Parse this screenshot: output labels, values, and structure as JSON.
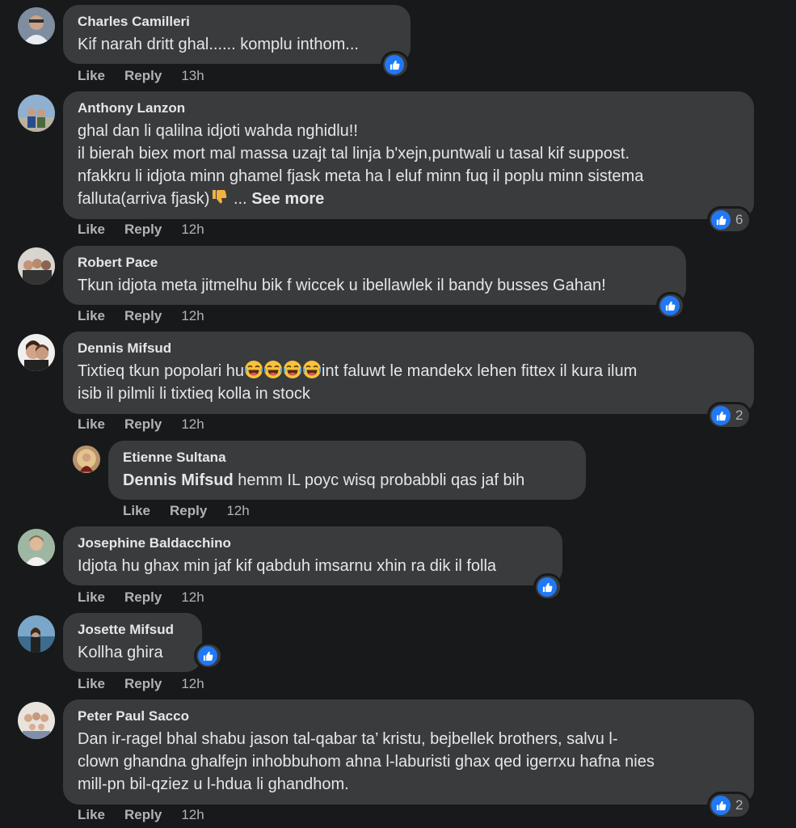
{
  "actions": {
    "like": "Like",
    "reply": "Reply"
  },
  "comments": [
    {
      "author": "Charles Camilleri",
      "text": "Kif narah dritt ghal...... komplu inthom...",
      "time": "13h",
      "reactions": ""
    },
    {
      "author": "Anthony Lanzon",
      "text": "ghal dan li qalilna idjoti wahda nghidlu!!\nil bierah biex mort mal massa uzajt tal linja b'xejn,puntwali u tasal kif suppost.\nnfakkru li idjota minn ghamel fjask meta ha l eluf minn fuq il poplu minn sistema\nfalluta(arriva fjask)",
      "see_more": "See more",
      "time": "12h",
      "reactions": "6"
    },
    {
      "author": "Robert Pace",
      "text": "Tkun idjota meta jitmelhu bik f wiccek u ibellawlek il bandy busses Gahan!",
      "time": "12h",
      "reactions": ""
    },
    {
      "author": "Dennis Mifsud",
      "text_a": "Tixtieq tkun popolari hu",
      "text_b": "int faluwt le mandekx lehen fittex il kura ilum\nisib il pilmli li tixtieq kolla in stock",
      "time": "12h",
      "reactions": "2"
    },
    {
      "author": "Etienne Sultana",
      "mention": "Dennis Mifsud",
      "text": " hemm IL poyc wisq probabbli qas jaf bih",
      "time": "12h",
      "reactions": ""
    },
    {
      "author": "Josephine Baldacchino",
      "text": "Idjota hu ghax min jaf kif qabduh imsarnu xhin ra dik il folla",
      "time": "12h",
      "reactions": ""
    },
    {
      "author": "Josette Mifsud",
      "text": "Kollha ghira",
      "time": "12h",
      "reactions": ""
    },
    {
      "author": "Peter Paul Sacco",
      "text": "Dan ir-ragel bhal shabu jason tal-qabar ta’ kristu, bejbellek brothers, salvu l-\nclown ghandna ghalfejn inhobbuhom ahna l-laburisti ghax qed igerrxu hafna nies\nmill-pn bil-qziez u l-hdua li ghandhom.",
      "time": "12h",
      "reactions": "2"
    }
  ],
  "colors": {
    "background": "#18191a",
    "bubble": "#3a3b3c",
    "like_blue": "#2078f4",
    "secondary_text": "#b0b3b8"
  }
}
